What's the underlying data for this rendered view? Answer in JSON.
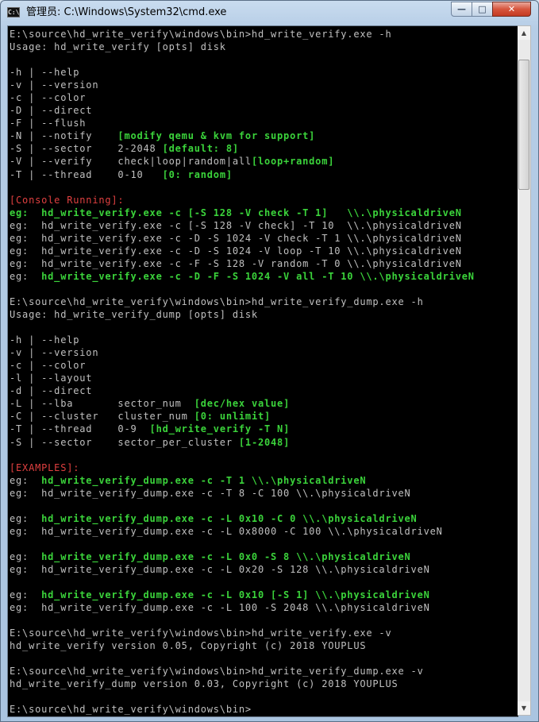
{
  "window": {
    "icon_label": "C:\\",
    "title": "管理员: C:\\Windows\\System32\\cmd.exe",
    "controls": {
      "minimize": "—",
      "maximize": "□",
      "close": "✕"
    }
  },
  "colors": {
    "console_bg": "#000000",
    "default_text": "#c0c0c0",
    "green": "#3bd43b",
    "red": "#e04040"
  },
  "scrollbar": {
    "up_icon": "▲",
    "down_icon": "▼"
  },
  "console": {
    "lines": [
      [
        [
          "w",
          "E:\\source\\hd_write_verify\\windows\\bin>hd_write_verify.exe -h"
        ]
      ],
      [
        [
          "w",
          "Usage: hd_write_verify [opts] disk"
        ]
      ],
      [
        [
          "w",
          ""
        ]
      ],
      [
        [
          "w",
          "-h | --help"
        ]
      ],
      [
        [
          "w",
          "-v | --version"
        ]
      ],
      [
        [
          "w",
          "-c | --color"
        ]
      ],
      [
        [
          "w",
          "-D | --direct"
        ]
      ],
      [
        [
          "w",
          "-F | --flush"
        ]
      ],
      [
        [
          "w",
          "-N | --notify    "
        ],
        [
          "gb",
          "[modify qemu & kvm for support]"
        ]
      ],
      [
        [
          "w",
          "-S | --sector    2-2048 "
        ],
        [
          "gb",
          "[default: 8]"
        ]
      ],
      [
        [
          "w",
          "-V | --verify    check|loop|random|all"
        ],
        [
          "gb",
          "[loop+random]"
        ]
      ],
      [
        [
          "w",
          "-T | --thread    0-10   "
        ],
        [
          "gb",
          "[0: random]"
        ]
      ],
      [
        [
          "w",
          ""
        ]
      ],
      [
        [
          "r",
          "[Console Running]:"
        ]
      ],
      [
        [
          "gb",
          "eg:  hd_write_verify.exe -c [-S 128 -V check -T 1]   \\\\.\\physicaldriveN"
        ]
      ],
      [
        [
          "w",
          "eg:  hd_write_verify.exe -c [-S 128 -V check] -T 10  \\\\.\\physicaldriveN"
        ]
      ],
      [
        [
          "w",
          "eg:  hd_write_verify.exe -c -D -S 1024 -V check -T 1 \\\\.\\physicaldriveN"
        ]
      ],
      [
        [
          "w",
          "eg:  hd_write_verify.exe -c -D -S 1024 -V loop -T 10 \\\\.\\physicaldriveN"
        ]
      ],
      [
        [
          "w",
          "eg:  hd_write_verify.exe -c -F -S 128 -V random -T 0 \\\\.\\physicaldriveN"
        ]
      ],
      [
        [
          "w",
          "eg:  "
        ],
        [
          "gb",
          "hd_write_verify.exe -c -D -F -S 1024 -V all -T 10 \\\\.\\physicaldriveN"
        ]
      ],
      [
        [
          "w",
          ""
        ]
      ],
      [
        [
          "w",
          "E:\\source\\hd_write_verify\\windows\\bin>hd_write_verify_dump.exe -h"
        ]
      ],
      [
        [
          "w",
          "Usage: hd_write_verify_dump [opts] disk"
        ]
      ],
      [
        [
          "w",
          ""
        ]
      ],
      [
        [
          "w",
          "-h | --help"
        ]
      ],
      [
        [
          "w",
          "-v | --version"
        ]
      ],
      [
        [
          "w",
          "-c | --color"
        ]
      ],
      [
        [
          "w",
          "-l | --layout"
        ]
      ],
      [
        [
          "w",
          "-d | --direct"
        ]
      ],
      [
        [
          "w",
          "-L | --lba       sector_num  "
        ],
        [
          "gb",
          "[dec/hex value]"
        ]
      ],
      [
        [
          "w",
          "-C | --cluster   cluster_num "
        ],
        [
          "gb",
          "[0: unlimit]"
        ]
      ],
      [
        [
          "w",
          "-T | --thread    0-9  "
        ],
        [
          "gb",
          "[hd_write_verify -T N]"
        ]
      ],
      [
        [
          "w",
          "-S | --sector    sector_per_cluster "
        ],
        [
          "gb",
          "[1-2048]"
        ]
      ],
      [
        [
          "w",
          ""
        ]
      ],
      [
        [
          "r",
          "[EXAMPLES]:"
        ]
      ],
      [
        [
          "w",
          "eg:  "
        ],
        [
          "gb",
          "hd_write_verify_dump.exe -c -T 1 \\\\.\\physicaldriveN"
        ]
      ],
      [
        [
          "w",
          "eg:  hd_write_verify_dump.exe -c -T 8 -C 100 \\\\.\\physicaldriveN"
        ]
      ],
      [
        [
          "w",
          ""
        ]
      ],
      [
        [
          "w",
          "eg:  "
        ],
        [
          "gb",
          "hd_write_verify_dump.exe -c -L 0x10 -C 0 \\\\.\\physicaldriveN"
        ]
      ],
      [
        [
          "w",
          "eg:  hd_write_verify_dump.exe -c -L 0x8000 -C 100 \\\\.\\physicaldriveN"
        ]
      ],
      [
        [
          "w",
          ""
        ]
      ],
      [
        [
          "w",
          "eg:  "
        ],
        [
          "gb",
          "hd_write_verify_dump.exe -c -L 0x0 -S 8 \\\\.\\physicaldriveN"
        ]
      ],
      [
        [
          "w",
          "eg:  hd_write_verify_dump.exe -c -L 0x20 -S 128 \\\\.\\physicaldriveN"
        ]
      ],
      [
        [
          "w",
          ""
        ]
      ],
      [
        [
          "w",
          "eg:  "
        ],
        [
          "gb",
          "hd_write_verify_dump.exe -c -L 0x10 [-S 1] \\\\.\\physicaldriveN"
        ]
      ],
      [
        [
          "w",
          "eg:  hd_write_verify_dump.exe -c -L 100 -S 2048 \\\\.\\physicaldriveN"
        ]
      ],
      [
        [
          "w",
          ""
        ]
      ],
      [
        [
          "w",
          "E:\\source\\hd_write_verify\\windows\\bin>hd_write_verify.exe -v"
        ]
      ],
      [
        [
          "w",
          "hd_write_verify version 0.05, Copyright (c) 2018 YOUPLUS"
        ]
      ],
      [
        [
          "w",
          ""
        ]
      ],
      [
        [
          "w",
          "E:\\source\\hd_write_verify\\windows\\bin>hd_write_verify_dump.exe -v"
        ]
      ],
      [
        [
          "w",
          "hd_write_verify_dump version 0.03, Copyright (c) 2018 YOUPLUS"
        ]
      ],
      [
        [
          "w",
          ""
        ]
      ],
      [
        [
          "w",
          "E:\\source\\hd_write_verify\\windows\\bin>"
        ]
      ]
    ]
  }
}
